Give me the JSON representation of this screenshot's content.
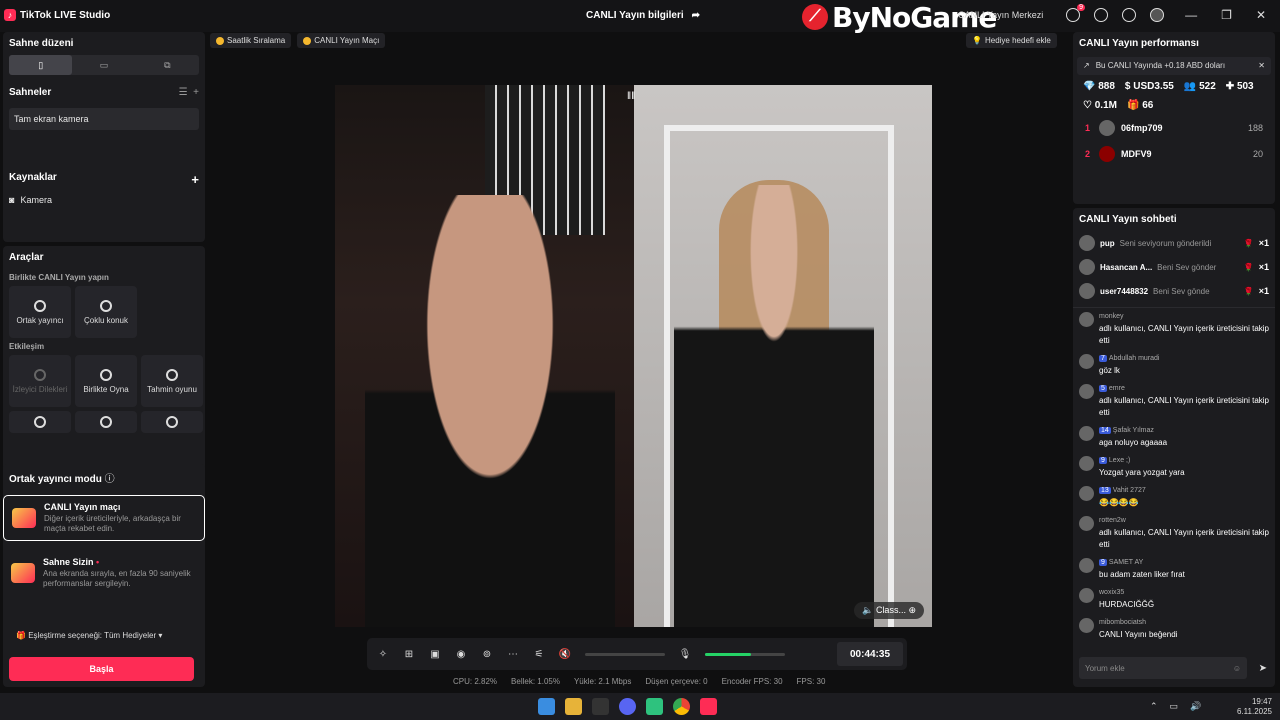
{
  "titlebar": {
    "app_name": "TikTok LIVE Studio",
    "center_title": "CANLI Yayın bilgileri",
    "watermark": "ByNoGame",
    "live_center": "CANLI Yayın Merkezi",
    "notif_count": "9"
  },
  "left": {
    "stage_layout": "Sahne düzeni",
    "scenes_title": "Sahneler",
    "scene_item": "Tam ekran kamera",
    "sources_title": "Kaynaklar",
    "source_item": "Kamera",
    "tools_title": "Araçlar",
    "collab_sub": "Birlikte CANLI Yayın yapın",
    "tools_row1": [
      "Ortak yayıncı",
      "Çoklu konuk"
    ],
    "interaction_sub": "Etkileşim",
    "tools_row2": [
      "İzleyici Dilekleri",
      "Birlikte Oyna",
      "Tahmin oyunu"
    ],
    "cohost_mode": "Ortak yayıncı modu",
    "mode1_name": "CANLI Yayın maçı",
    "mode1_desc": "Diğer içerik üreticileriyle, arkadaşça bir maçta rekabet edin.",
    "mode2_name": "Sahne Sizin",
    "mode2_desc": "Ana ekranda sırayla, en fazla 90 saniyelik performanslar sergileyin.",
    "match_option": "Eşleştirme seçeneği: Tüm Hediyeler",
    "start_label": "Başla"
  },
  "top": {
    "pill1": "Saatlik Sıralama",
    "pill2": "CANLI Yayın Maçı",
    "gift_goal": "Hediye hedefi ekle"
  },
  "video": {
    "right_label": "Class..."
  },
  "controls": {
    "timer": "00:44:35",
    "mic_level": 0.58
  },
  "stats": [
    "CPU:  2.82%",
    "Bellek:  1.05%",
    "Yükle:  2.1 Mbps",
    "Düşen çerçeve:  0",
    "Encoder FPS:  30",
    "FPS:  30"
  ],
  "right": {
    "perf_title": "CANLI Yayın performansı",
    "perf_banner": "Bu CANLI Yayında +0.18 ABD doları",
    "stat1": "888",
    "stat2": "USD3.55",
    "stat3": "522",
    "stat4": "503",
    "stat5": "0.1M",
    "stat6": "66",
    "ranks": [
      {
        "n": "1",
        "name": "06fmp709",
        "score": "188"
      },
      {
        "n": "2",
        "name": "MDFV9",
        "score": "20"
      }
    ],
    "chat_title": "CANLI Yayın sohbeti",
    "gifts": [
      {
        "u": "pup",
        "g": "Seni seviyorum gönderildi",
        "x": "×1"
      },
      {
        "u": "Hasancan A...",
        "g": "Beni Sev gönder",
        "x": "×1"
      },
      {
        "u": "user7448832",
        "g": "Beni Sev gönde",
        "x": "×1"
      }
    ],
    "messages": [
      {
        "name": "monkey",
        "lvl": "",
        "text": "adlı kullanıcı, CANLI Yayın içerik üreticisini takip etti"
      },
      {
        "name": "Abdullah muradi",
        "lvl": "7",
        "text": "göz lk"
      },
      {
        "name": "emre",
        "lvl": "5",
        "text": "adlı kullanıcı, CANLI Yayın içerik üreticisini takip etti"
      },
      {
        "name": "Şafak Yılmaz",
        "lvl": "14",
        "text": "aga noluyo agaaaa"
      },
      {
        "name": "Lexe ;)",
        "lvl": "9",
        "text": "Yozgat yara yozgat yara"
      },
      {
        "name": "Vahit 2727",
        "lvl": "13",
        "text": "😂😂😂😂"
      },
      {
        "name": "rotten2w",
        "lvl": "",
        "text": "adlı kullanıcı, CANLI Yayın içerik üreticisini takip etti"
      },
      {
        "name": "SAMET AY",
        "lvl": "9",
        "text": "bu adam zaten liker fırat"
      },
      {
        "name": "woxix35",
        "lvl": "",
        "text": "HURDACIĞĞĞ"
      },
      {
        "name": "mibombociatsh",
        "lvl": "",
        "text": "CANLI Yayını beğendi"
      }
    ],
    "chat_placeholder": "Yorum ekle"
  },
  "taskbar": {
    "time": "19:47",
    "date": "6.11.2025"
  }
}
